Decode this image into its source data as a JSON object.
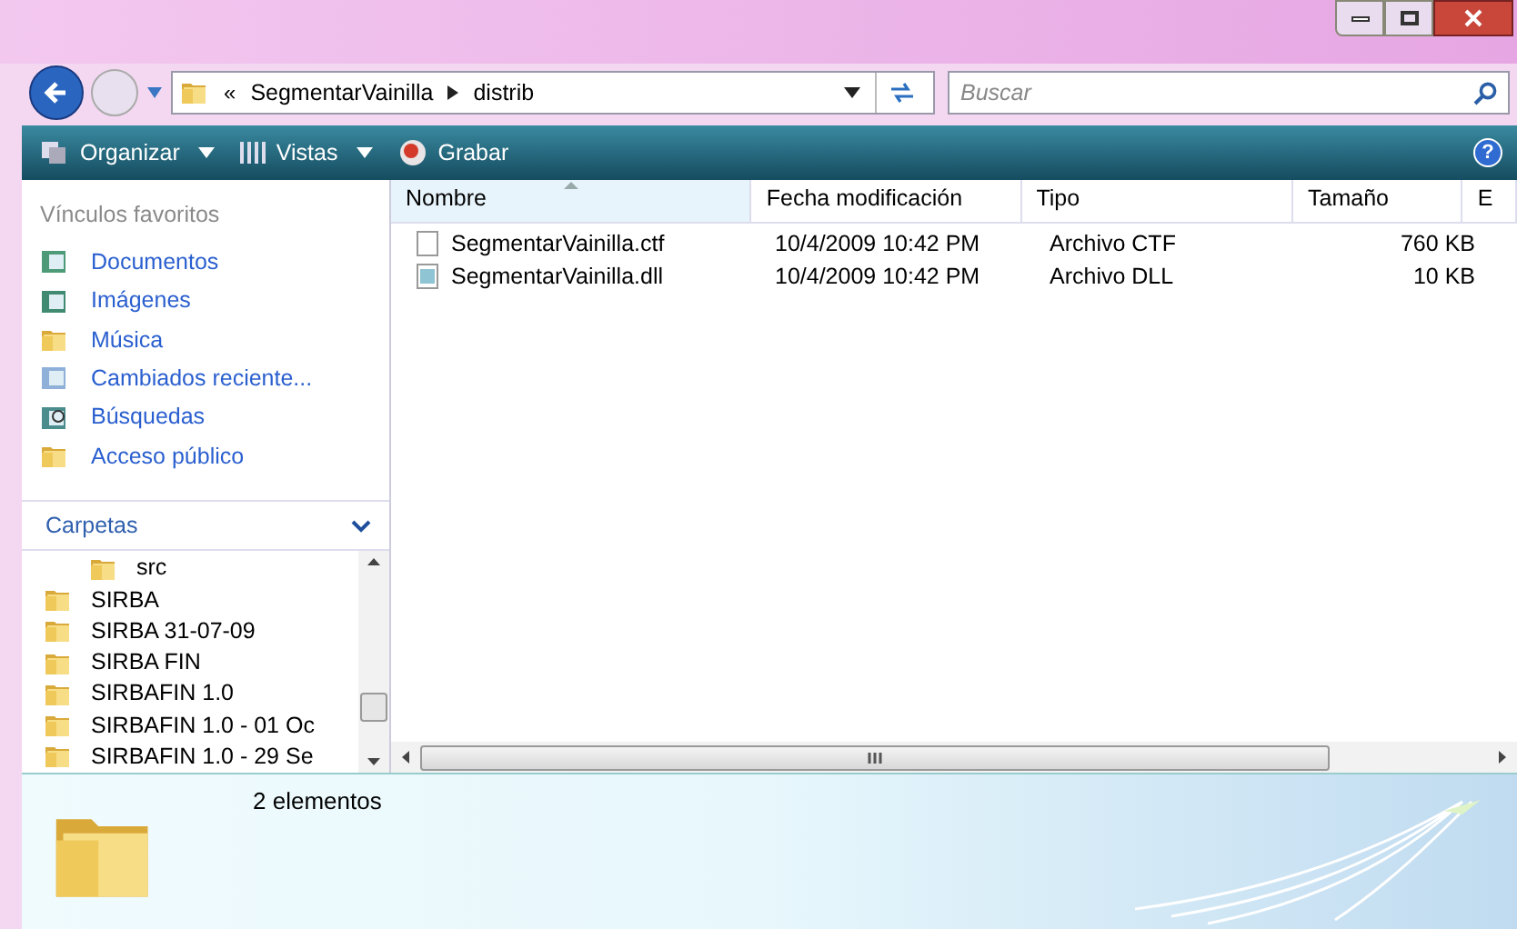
{
  "address_bar": {
    "overflow": "«",
    "crumbs": [
      "SegmentarVainilla",
      "distrib"
    ]
  },
  "search": {
    "placeholder": "Buscar"
  },
  "toolbar": {
    "buttons": [
      {
        "label": "Organizar",
        "kind": "menu"
      },
      {
        "label": "Vistas",
        "kind": "views"
      },
      {
        "label": "Grabar",
        "kind": "burn"
      }
    ],
    "help": "?"
  },
  "favorites": {
    "title": "Vínculos favoritos",
    "items": [
      {
        "label": "Documentos",
        "kind": "documents"
      },
      {
        "label": "Imágenes",
        "kind": "pictures"
      },
      {
        "label": "Música",
        "kind": "folder"
      },
      {
        "label": "Cambiados reciente...",
        "kind": "recent"
      },
      {
        "label": "Búsquedas",
        "kind": "searches"
      },
      {
        "label": "Acceso público",
        "kind": "folder"
      }
    ]
  },
  "folders": {
    "title": "Carpetas",
    "expanded": true,
    "items": [
      {
        "label": "src",
        "kind": "subfolder"
      },
      {
        "label": "SIRBA",
        "kind": "folder"
      },
      {
        "label": "SIRBA 31-07-09",
        "kind": "folder"
      },
      {
        "label": "SIRBA FIN",
        "kind": "folder"
      },
      {
        "label": "SIRBAFIN 1.0",
        "kind": "folder"
      },
      {
        "label": "SIRBAFIN 1.0 - 01 Oc",
        "kind": "folder"
      },
      {
        "label": "SIRBAFIN 1.0 - 29 Se",
        "kind": "folder"
      }
    ]
  },
  "table": {
    "columns": [
      {
        "label": "Nombre",
        "sorted": true
      },
      {
        "label": "Fecha modificación",
        "sorted": false
      },
      {
        "label": "Tipo",
        "sorted": false
      },
      {
        "label": "Tamaño",
        "sorted": false
      },
      {
        "label": "E",
        "sorted": false
      }
    ],
    "rows": [
      {
        "name": "SegmentarVainilla.ctf",
        "kind": "blank",
        "date": "10/4/2009 10:42 PM",
        "type": "Archivo CTF",
        "size": "760 KB"
      },
      {
        "name": "SegmentarVainilla.dll",
        "kind": "dll",
        "date": "10/4/2009 10:42 PM",
        "type": "Archivo DLL",
        "size": "10 KB"
      }
    ]
  },
  "status": {
    "count": "2 elementos"
  }
}
